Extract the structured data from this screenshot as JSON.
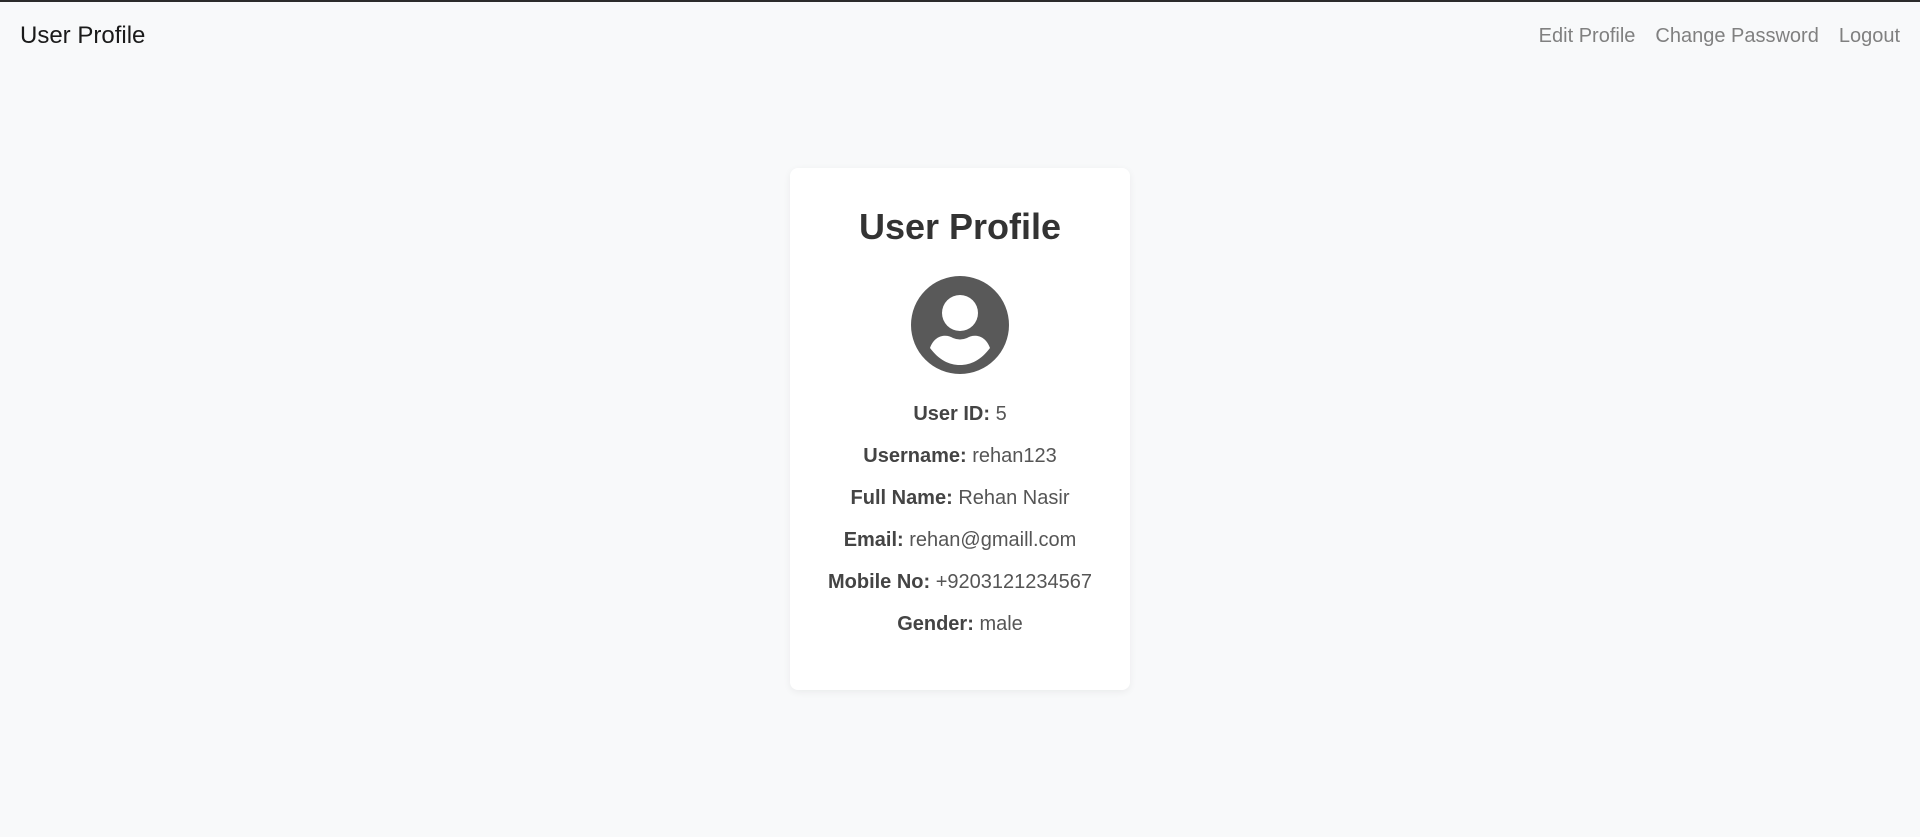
{
  "navbar": {
    "brand": "User Profile",
    "links": {
      "edit_profile": "Edit Profile",
      "change_password": "Change Password",
      "logout": "Logout"
    }
  },
  "card": {
    "title": "User Profile",
    "avatar_icon": "user-avatar-icon",
    "fields": {
      "user_id": {
        "label": "User ID:",
        "value": "5"
      },
      "username": {
        "label": "Username:",
        "value": "rehan123"
      },
      "full_name": {
        "label": "Full Name:",
        "value": "Rehan Nasir"
      },
      "email": {
        "label": "Email:",
        "value": "rehan@gmaill.com"
      },
      "mobile": {
        "label": "Mobile No:",
        "value": "+9203121234567"
      },
      "gender": {
        "label": "Gender:",
        "value": "male"
      }
    }
  },
  "colors": {
    "background": "#f8f9fa",
    "card": "#ffffff",
    "title": "#333333",
    "avatar": "#595959",
    "nav_link": "#808080"
  }
}
